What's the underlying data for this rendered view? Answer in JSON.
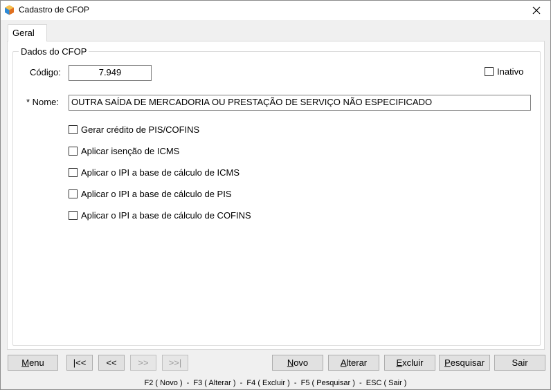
{
  "window": {
    "title": "Cadastro de CFOP"
  },
  "tabs": [
    {
      "label": "Geral"
    }
  ],
  "group": {
    "title": "Dados do CFOP"
  },
  "form": {
    "codigo_label": "Código:",
    "codigo_value": "7.949",
    "inativo_label": "Inativo",
    "nome_label": "* Nome:",
    "nome_value": "OUTRA SAÍDA DE MERCADORIA OU PRESTAÇÃO DE SERVIÇO NÃO ESPECIFICADO",
    "checkboxes": [
      {
        "label": "Gerar crédito de PIS/COFINS"
      },
      {
        "label": "Aplicar isenção de ICMS"
      },
      {
        "label": "Aplicar o IPI a base de cálculo de ICMS"
      },
      {
        "label": "Aplicar o IPI a base de cálculo de PIS"
      },
      {
        "label": "Aplicar o IPI a base de cálculo de COFINS"
      }
    ]
  },
  "buttons": {
    "menu": {
      "first": "M",
      "rest": "enu"
    },
    "first_record": "|<<",
    "prev_record": "<<",
    "next_record": ">>",
    "last_record": ">>|",
    "novo": {
      "first": "N",
      "rest": "ovo"
    },
    "alterar": {
      "first": "A",
      "rest": "lterar"
    },
    "excluir": {
      "first": "E",
      "rest": "xcluir"
    },
    "pesquisar": {
      "first": "P",
      "rest": "esquisar"
    },
    "sair": "Sair"
  },
  "status": {
    "shortcuts": "F2 ( Novo )  -  F3 ( Alterar )  -  F4 ( Excluir )  -  F5 ( Pesquisar )  -  ESC ( Sair )"
  },
  "colors": {
    "window_bg": "#f0f0f0",
    "panel_bg": "#ffffff",
    "button_bg": "#e1e1e1"
  }
}
